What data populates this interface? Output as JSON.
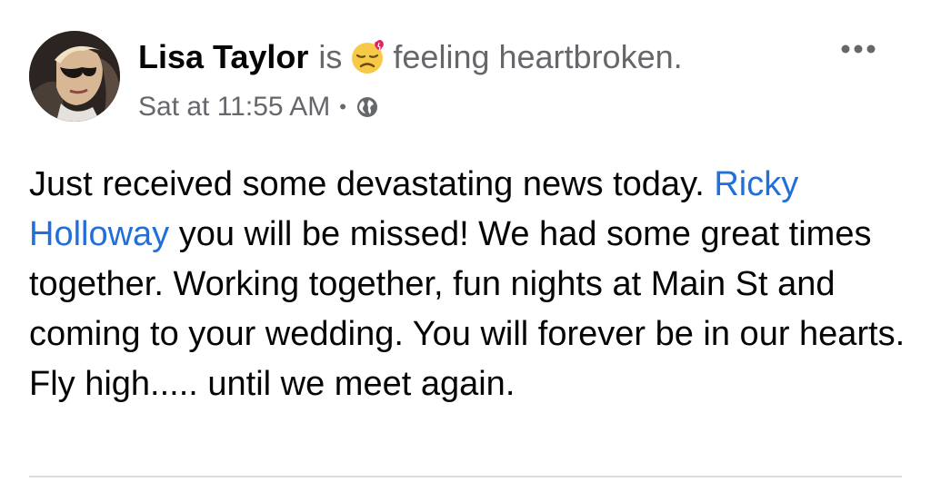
{
  "post": {
    "author": "Lisa Taylor",
    "verb": "is",
    "feeling_emoji": "heartbroken-face-emoji",
    "feeling_text": "feeling heartbroken.",
    "timestamp": "Sat at 11:55 AM",
    "separator": "•",
    "audience_icon": "globe-icon",
    "more_icon": "more-options-icon",
    "body": {
      "part1": "Just received some devastating news today. ",
      "mention": "Ricky Holloway",
      "part2": " you will be missed! We had some great times together. Working together, fun nights at Main St and coming to your wedding. You will forever be in our hearts. Fly high..... until we meet again."
    }
  },
  "colors": {
    "mention": "#216fdb",
    "secondary_text": "#65676b",
    "primary_text": "#050505",
    "divider": "#dadde1"
  }
}
